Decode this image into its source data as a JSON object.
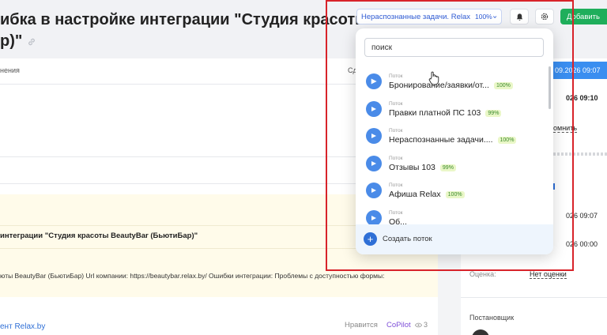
{
  "header": {
    "title_line1": "ибка в настройке интеграции \"Студия красоты",
    "title_line2": "р)\"",
    "flow_select": {
      "label": "Нераспознанные задачи. Relax",
      "percent": "100%"
    },
    "add_button": "Добавить"
  },
  "table": {
    "col1": "нения",
    "col2": "Сд"
  },
  "task": {
    "subject": "интеграции \"Студия красоты BeautyBar (БьютиБар)\"",
    "body": "юты BeautyBar (БьютиБар) Url компании: https://beautybar.relax.by/ Ошибки интеграции: Проблемы с доступностью формы:",
    "author": "ент Relax.by",
    "likes": "Нравится",
    "copilot": "CoPilot",
    "views": "3"
  },
  "right_panel": {
    "header_date": "09.2026 09:07",
    "date1": "026 09:10",
    "remind": "омнить",
    "date2": "026 09:07",
    "date3": "026 00:00",
    "rating_label": "Оценка:",
    "rating_value": "Нет оценки",
    "assigner_label": "Постановщик"
  },
  "dropdown": {
    "search_placeholder": "поиск",
    "items": [
      {
        "caption": "Поток",
        "name": "Бронирование/заявки/от...",
        "percent": "100%"
      },
      {
        "caption": "Поток",
        "name": "Правки платной ПС 103",
        "percent": "99%"
      },
      {
        "caption": "Поток",
        "name": "Нераспознанные задачи....",
        "percent": "100%"
      },
      {
        "caption": "Поток",
        "name": "Отзывы 103",
        "percent": "99%"
      },
      {
        "caption": "Поток",
        "name": "Афиша Relax",
        "percent": "100%"
      },
      {
        "caption": "Поток",
        "name": "Об...",
        "percent": ""
      }
    ],
    "create_label": "Создать поток"
  },
  "colors": {
    "accent": "#2f6fd6",
    "add_green": "#1fae5b",
    "highlight_red": "#d8232a",
    "flow_icon": "#4a8be8"
  }
}
